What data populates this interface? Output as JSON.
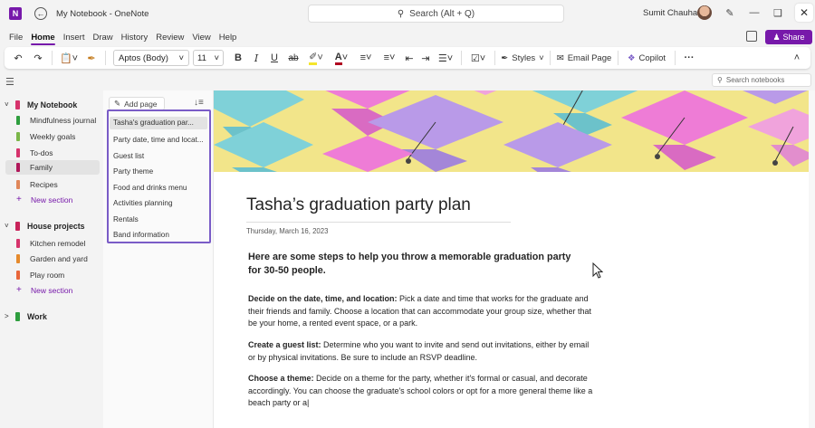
{
  "titlebar": {
    "app_icon": "N",
    "doc_title": "My Notebook - OneNote",
    "search_placeholder": "Search (Alt + Q)",
    "user_name": "Sumit Chauhan"
  },
  "menu": [
    "File",
    "Home",
    "Insert",
    "Draw",
    "History",
    "Review",
    "View",
    "Help"
  ],
  "share_label": "Share",
  "ribbon": {
    "font": "Aptos (Body)",
    "size": "11",
    "styles_label": "Styles",
    "email_label": "Email Page",
    "copilot_label": "Copilot"
  },
  "search_notebooks": "Search notebooks",
  "notebooks": [
    {
      "name": "My Notebook",
      "color": "#d6336c",
      "expanded": true,
      "sections": [
        {
          "name": "Mindfulness journal",
          "color": "#2e9e3e"
        },
        {
          "name": "Weekly goals",
          "color": "#7ab648"
        },
        {
          "name": "To-dos",
          "color": "#d6336c"
        },
        {
          "name": "Family",
          "color": "#b0185a",
          "selected": true
        },
        {
          "name": "Recipes",
          "color": "#e0875a"
        }
      ],
      "new_section": "New section"
    },
    {
      "name": "House projects",
      "color": "#c8235a",
      "expanded": true,
      "sections": [
        {
          "name": "Kitchen remodel",
          "color": "#d6336c"
        },
        {
          "name": "Garden and yard",
          "color": "#e58a2c"
        },
        {
          "name": "Play room",
          "color": "#e8663a"
        }
      ],
      "new_section": "New section"
    },
    {
      "name": "Work",
      "color": "#2e9e3e",
      "expanded": false,
      "sections": []
    }
  ],
  "pages": {
    "add_page": "Add page",
    "items": [
      "Tasha's graduation par...",
      "Party date, time and locat...",
      "Guest list",
      "Party theme",
      "Food and drinks menu",
      "Activities planning",
      "Rentals",
      "Band information"
    ]
  },
  "page": {
    "title": "Tasha’s graduation party plan",
    "date": "Thursday, March 16, 2023",
    "intro": "Here are some steps to help you throw a memorable graduation party for 30-50 people.",
    "paragraphs": [
      {
        "heading": "Decide on the date, time, and location:",
        "text": " Pick a date and time that works for the graduate and their friends and family. Choose a location that can accommodate your group size, whether that be your home, a rented event space, or a park."
      },
      {
        "heading": "Create a guest list:",
        "text": " Determine who you want to invite and send out invitations, either by email or by physical invitations. Be sure to include an RSVP deadline."
      },
      {
        "heading": "Choose a theme:",
        "text": " Decide on a theme for the party, whether it's formal or casual, and decorate accordingly. You can choose the graduate's school colors or opt for a more general theme like a beach party or a|"
      }
    ]
  }
}
